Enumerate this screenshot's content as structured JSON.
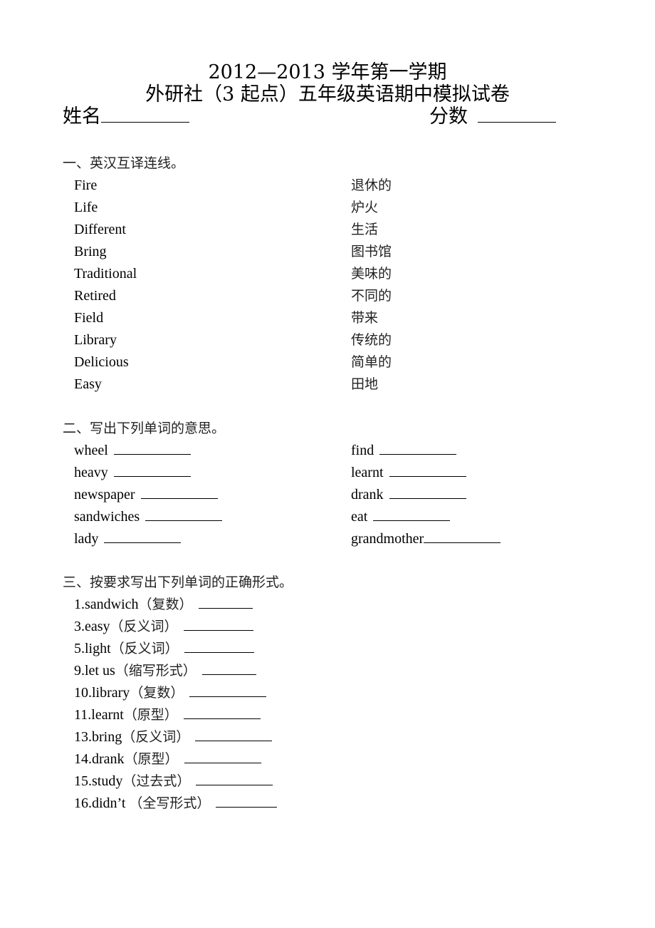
{
  "header": {
    "title_line1": "2012—2013 学年第一学期",
    "title_line2": "外研社（3 起点）五年级英语期中模拟试卷",
    "name_label": "姓名",
    "score_label": "分数"
  },
  "section1": {
    "heading": "一、英汉互译连线。",
    "english": [
      "Fire",
      "Life",
      "Different",
      "Bring",
      "Traditional",
      "Retired",
      "Field",
      "Library",
      "Delicious",
      "Easy"
    ],
    "chinese": [
      "退休的",
      "炉火",
      "生活",
      "图书馆",
      "美味的",
      "不同的",
      "带来",
      "传统的",
      "简单的",
      "田地"
    ]
  },
  "section2": {
    "heading": "二、写出下列单词的意思。",
    "left": [
      "wheel",
      "heavy",
      "newspaper",
      "sandwiches",
      "lady"
    ],
    "right": [
      "find",
      "learnt",
      "drank",
      "eat",
      "grandmother"
    ]
  },
  "section3": {
    "heading": "三、按要求写出下列单词的正确形式。",
    "items": [
      {
        "word": "1.sandwich",
        "hint": "（复数）"
      },
      {
        "word": "3.easy",
        "hint": "（反义词）"
      },
      {
        "word": "5.light",
        "hint": "（反义词）"
      },
      {
        "word": "9.let us",
        "hint": "（缩写形式）"
      },
      {
        "word": "10.library",
        "hint": "（复数）"
      },
      {
        "word": "11.learnt",
        "hint": "（原型）"
      },
      {
        "word": "13.bring",
        "hint": "（反义词）"
      },
      {
        "word": "14.drank",
        "hint": "（原型）"
      },
      {
        "word": "15.study",
        "hint": "（过去式）"
      },
      {
        "word": "16.didn’t ",
        "hint": "（全写形式）"
      }
    ]
  }
}
